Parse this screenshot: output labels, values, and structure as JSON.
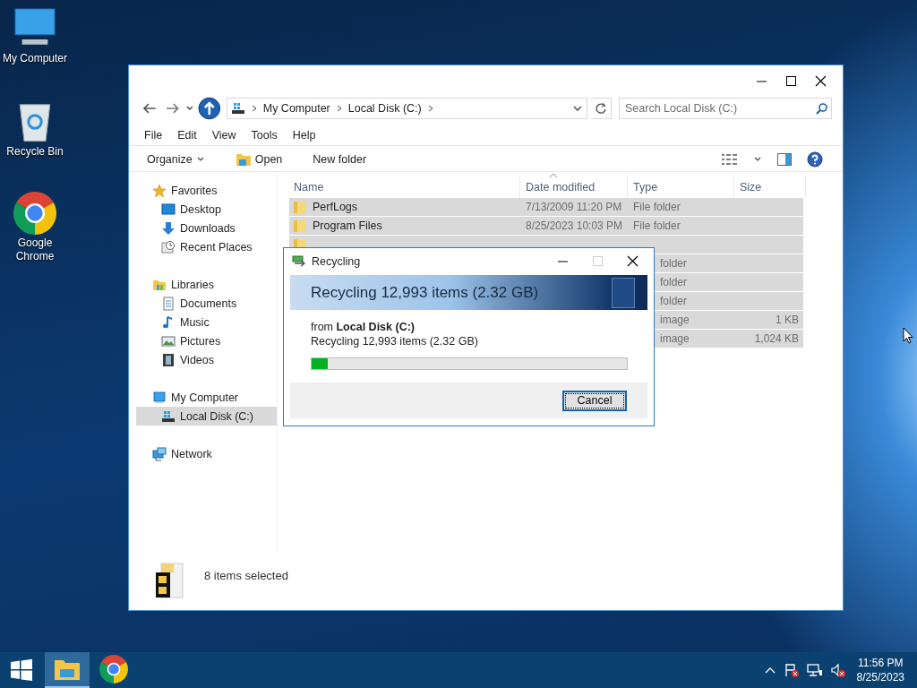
{
  "desktop_icons": [
    {
      "label": "My Computer",
      "kind": "computer"
    },
    {
      "label": "Recycle Bin",
      "kind": "recycle"
    },
    {
      "label": "Google Chrome",
      "kind": "chrome"
    }
  ],
  "explorer": {
    "address": {
      "crumbs": [
        "My Computer",
        "Local Disk (C:)"
      ]
    },
    "search": {
      "placeholder": "Search Local Disk (C:)"
    },
    "menu": [
      "File",
      "Edit",
      "View",
      "Tools",
      "Help"
    ],
    "commands": [
      {
        "label": "Organize",
        "kind": "dropdown"
      },
      {
        "label": "Open",
        "kind": "open"
      },
      {
        "label": "New folder",
        "kind": "plain"
      }
    ],
    "nav": [
      {
        "label": "Favorites",
        "kind": "star",
        "selected": false,
        "children": [
          {
            "label": "Desktop",
            "kind": "desktop",
            "selected": false
          },
          {
            "label": "Downloads",
            "kind": "download",
            "selected": false
          },
          {
            "label": "Recent Places",
            "kind": "recent",
            "selected": false
          }
        ]
      },
      {
        "label": "Libraries",
        "kind": "library",
        "selected": false,
        "children": [
          {
            "label": "Documents",
            "kind": "document",
            "selected": false
          },
          {
            "label": "Music",
            "kind": "music",
            "selected": false
          },
          {
            "label": "Pictures",
            "kind": "picture",
            "selected": false
          },
          {
            "label": "Videos",
            "kind": "video",
            "selected": false
          }
        ]
      },
      {
        "label": "My Computer",
        "kind": "computer",
        "selected": false,
        "children": [
          {
            "label": "Local Disk (C:)",
            "kind": "disk",
            "selected": true
          }
        ]
      },
      {
        "label": "Network",
        "kind": "network",
        "selected": false
      }
    ],
    "columns": [
      "Name",
      "Date modified",
      "Type",
      "Size"
    ],
    "rows": [
      {
        "kind": "folder",
        "name": "PerfLogs",
        "date": "7/13/2009 11:20 PM",
        "type": "File folder",
        "selected": true
      },
      {
        "kind": "folder",
        "name": "Program Files",
        "date": "8/25/2023 10:03 PM",
        "type": "File folder",
        "selected": true
      },
      {
        "kind": "folder",
        "selected": true
      },
      {
        "type": "folder",
        "selected": true
      },
      {
        "type": "folder",
        "selected": true
      },
      {
        "type": "folder",
        "selected": true
      },
      {
        "type": "image",
        "size": "1 KB",
        "selected": true
      },
      {
        "type": "image",
        "size": "1,024 KB",
        "selected": true
      }
    ],
    "status": "8 items selected"
  },
  "dialog": {
    "title": "Recycling",
    "heading": "Recycling 12,993 items (2.32 GB)",
    "source": "from **Local Disk (C:)**",
    "detail": "Recycling 12,993 items (2.32 GB)",
    "level": 0.05,
    "buttons": [
      "Cancel"
    ]
  },
  "taskbar": {
    "apps": [
      {
        "kind": "explorer",
        "selected": true
      },
      {
        "kind": "chrome",
        "selected": false
      }
    ],
    "time": "11:56 PM",
    "date": "8/25/2023"
  }
}
